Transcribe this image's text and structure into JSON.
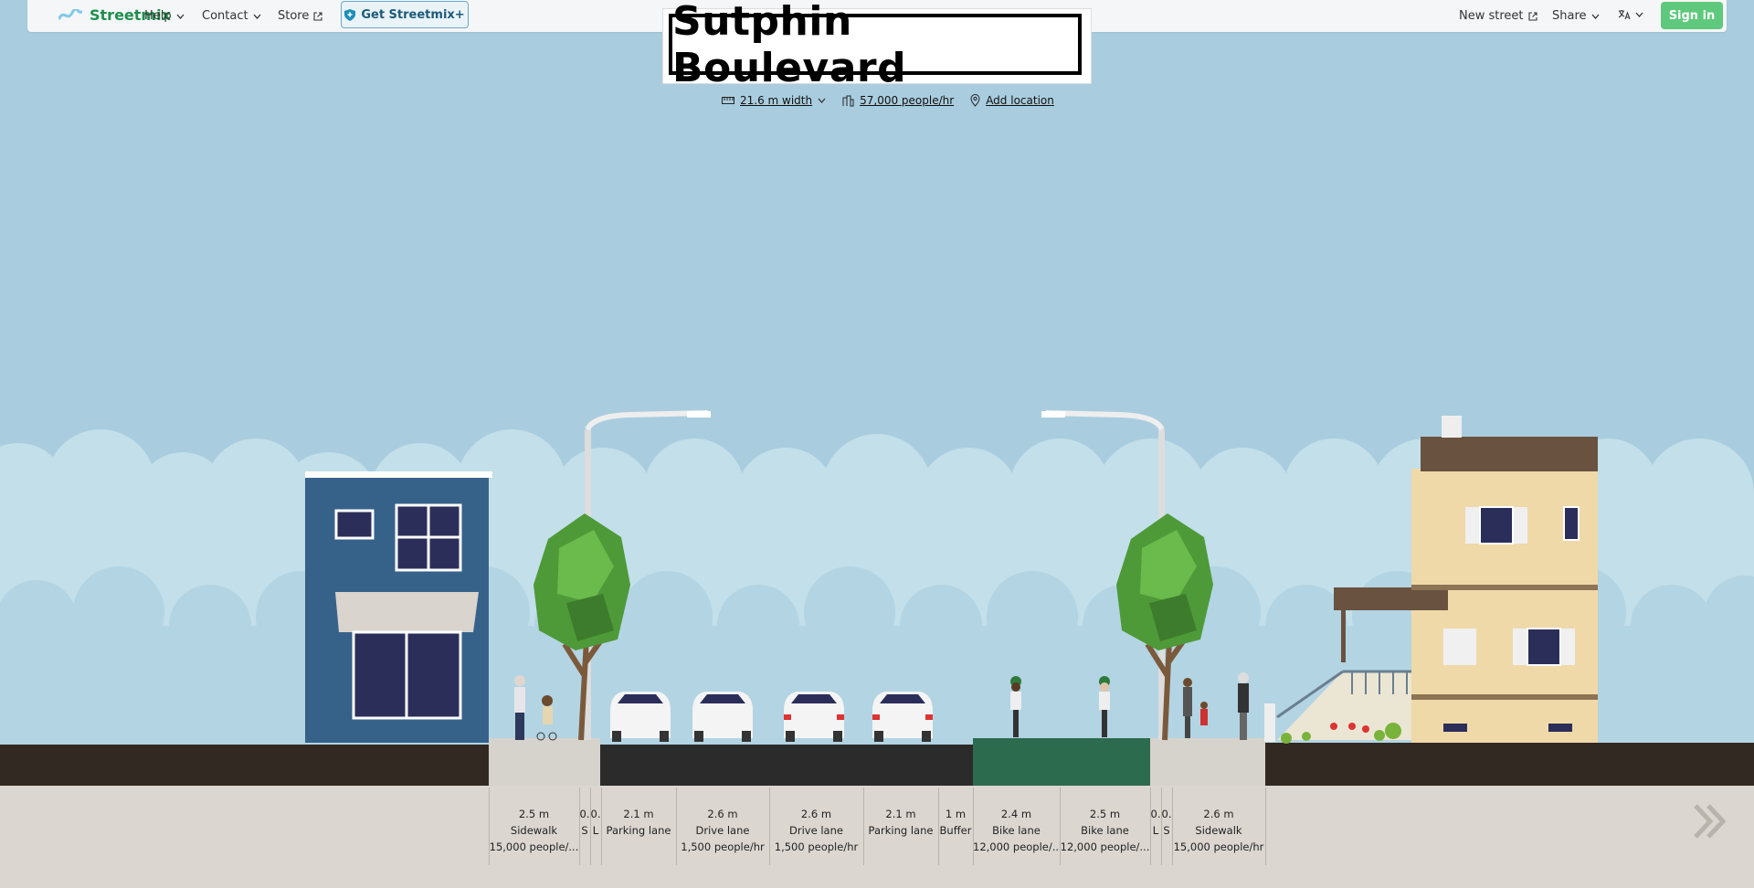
{
  "nav": {
    "logo": "Streetmix",
    "help": "Help",
    "contact": "Contact",
    "store": "Store",
    "get_plus": "Get Streetmix+",
    "new_street": "New street",
    "share": "Share",
    "sign_in": "Sign in"
  },
  "street": {
    "name": "Sutphin Boulevard",
    "width": "21.6 m width",
    "capacity": "57,000 people/hr",
    "location": "Add location"
  },
  "segments": [
    {
      "width": "2.5 m",
      "name": "Sidewalk",
      "capacity": "15,000 people/..."
    },
    {
      "width": "0.",
      "name": "S",
      "capacity": ""
    },
    {
      "width": "0.",
      "name": "L",
      "capacity": ""
    },
    {
      "width": "2.1 m",
      "name": "Parking lane",
      "capacity": ""
    },
    {
      "width": "2.6 m",
      "name": "Drive lane",
      "capacity": "1,500 people/hr"
    },
    {
      "width": "2.6 m",
      "name": "Drive lane",
      "capacity": "1,500 people/hr"
    },
    {
      "width": "2.1 m",
      "name": "Parking lane",
      "capacity": ""
    },
    {
      "width": "1 m",
      "name": "Buffer",
      "capacity": ""
    },
    {
      "width": "2.4 m",
      "name": "Bike lane",
      "capacity": "12,000 people/..."
    },
    {
      "width": "2.5 m",
      "name": "Bike lane",
      "capacity": "12,000 people/..."
    },
    {
      "width": "0.",
      "name": "L",
      "capacity": ""
    },
    {
      "width": "0.",
      "name": "S",
      "capacity": ""
    },
    {
      "width": "2.6 m",
      "name": "Sidewalk",
      "capacity": "15,000 people/hr"
    }
  ],
  "colors": {
    "sky": "#a9cddf",
    "asphalt": "#2b2b2b",
    "bike_lane": "#2d6b4f",
    "sidewalk": "#d6d2cc",
    "brand": "#1e8f4e"
  }
}
